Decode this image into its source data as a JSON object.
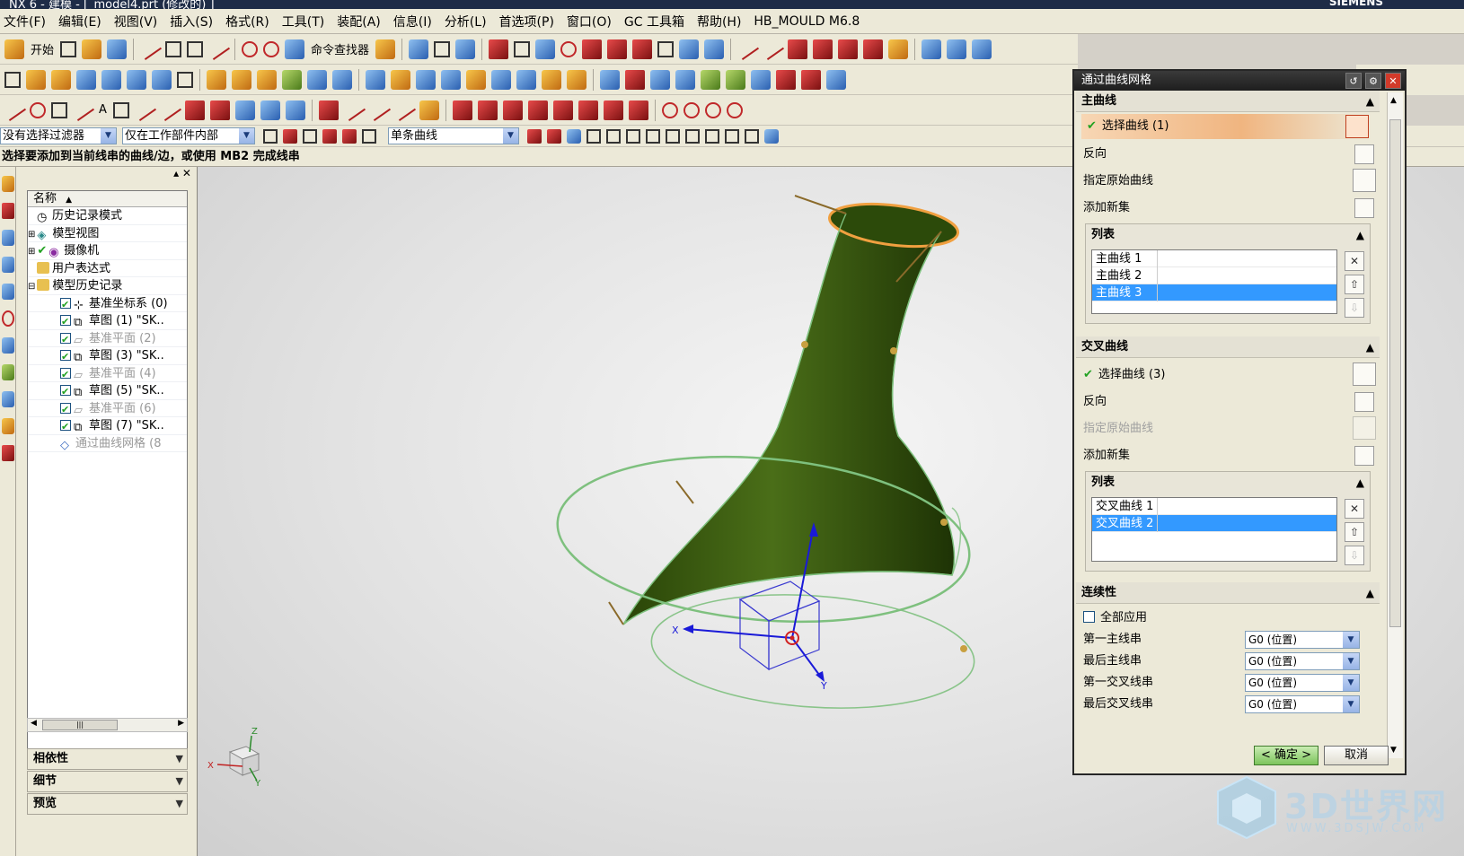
{
  "window": {
    "title": "NX 6 - 建模 - [_model4.prt (修改的) ]",
    "brand": "SIEMENS"
  },
  "menu": [
    "文件(F)",
    "编辑(E)",
    "视图(V)",
    "插入(S)",
    "格式(R)",
    "工具(T)",
    "装配(A)",
    "信息(I)",
    "分析(L)",
    "首选项(P)",
    "窗口(O)",
    "GC 工具箱",
    "帮助(H)",
    "HB_MOULD M6.8"
  ],
  "toolbar": {
    "start_label": "开始",
    "command_finder_label": "命令查找器"
  },
  "filters": {
    "selection_filter": "没有选择过滤器",
    "scope": "仅在工作部件内部",
    "curve_rule": "单条曲线"
  },
  "status": "选择要添加到当前线串的曲线/边，或使用 MB2 完成线串",
  "navigator": {
    "column_header": "名称",
    "items": [
      {
        "label": "历史记录模式",
        "dim": false,
        "checked": false
      },
      {
        "label": "模型视图",
        "dim": false,
        "checked": false
      },
      {
        "label": "摄像机",
        "dim": false,
        "checked": true
      },
      {
        "label": "用户表达式",
        "dim": false,
        "checked": false
      },
      {
        "label": "模型历史记录",
        "dim": false,
        "checked": false
      },
      {
        "label": "基准坐标系 (0)",
        "dim": false,
        "checked": true
      },
      {
        "label": "草图 (1) \"SK..",
        "dim": false,
        "checked": true
      },
      {
        "label": "基准平面 (2)",
        "dim": true,
        "checked": true
      },
      {
        "label": "草图 (3) \"SK..",
        "dim": false,
        "checked": true
      },
      {
        "label": "基准平面 (4)",
        "dim": true,
        "checked": true
      },
      {
        "label": "草图 (5) \"SK..",
        "dim": false,
        "checked": true
      },
      {
        "label": "基准平面 (6)",
        "dim": true,
        "checked": true
      },
      {
        "label": "草图 (7) \"SK..",
        "dim": false,
        "checked": true
      },
      {
        "label": "通过曲线网格 (8",
        "dim": true,
        "checked": false
      }
    ],
    "panels": [
      "相依性",
      "细节",
      "预览"
    ]
  },
  "dialog": {
    "title": "通过曲线网格",
    "primary": {
      "header": "主曲线",
      "select_label": "选择曲线 (1)",
      "reverse_label": "反向",
      "origin_label": "指定原始曲线",
      "add_set_label": "添加新集",
      "list_header": "列表",
      "list_items": [
        "主曲线 1",
        "主曲线 2",
        "主曲线 3"
      ],
      "selected_index": 2
    },
    "cross": {
      "header": "交叉曲线",
      "select_label": "选择曲线 (3)",
      "reverse_label": "反向",
      "origin_label": "指定原始曲线",
      "add_set_label": "添加新集",
      "list_header": "列表",
      "list_items": [
        "交叉曲线 1",
        "交叉曲线 2"
      ],
      "selected_index": 1
    },
    "continuity": {
      "header": "连续性",
      "apply_all_label": "全部应用",
      "rows": [
        {
          "label": "第一主线串",
          "value": "G0 (位置)"
        },
        {
          "label": "最后主线串",
          "value": "G0 (位置)"
        },
        {
          "label": "第一交叉线串",
          "value": "G0 (位置)"
        },
        {
          "label": "最后交叉线串",
          "value": "G0 (位置)"
        }
      ]
    },
    "ok_label": "< 确定 >",
    "cancel_label": "取消"
  },
  "viewport": {
    "axis_labels": {
      "x": "X",
      "y": "Y",
      "z": "Z"
    },
    "triad_labels": {
      "x": "X",
      "y": "Y",
      "z": "Z"
    }
  },
  "watermark": {
    "title": "3D世界网",
    "subtitle": "WWW.3DSJW.COM"
  },
  "colors": {
    "surface": "#3d5a12",
    "selected_curve": "#f0a040",
    "section_curve": "#7ec07e",
    "selection_blue": "#3399ff",
    "ok_button": "#7cc45b"
  }
}
